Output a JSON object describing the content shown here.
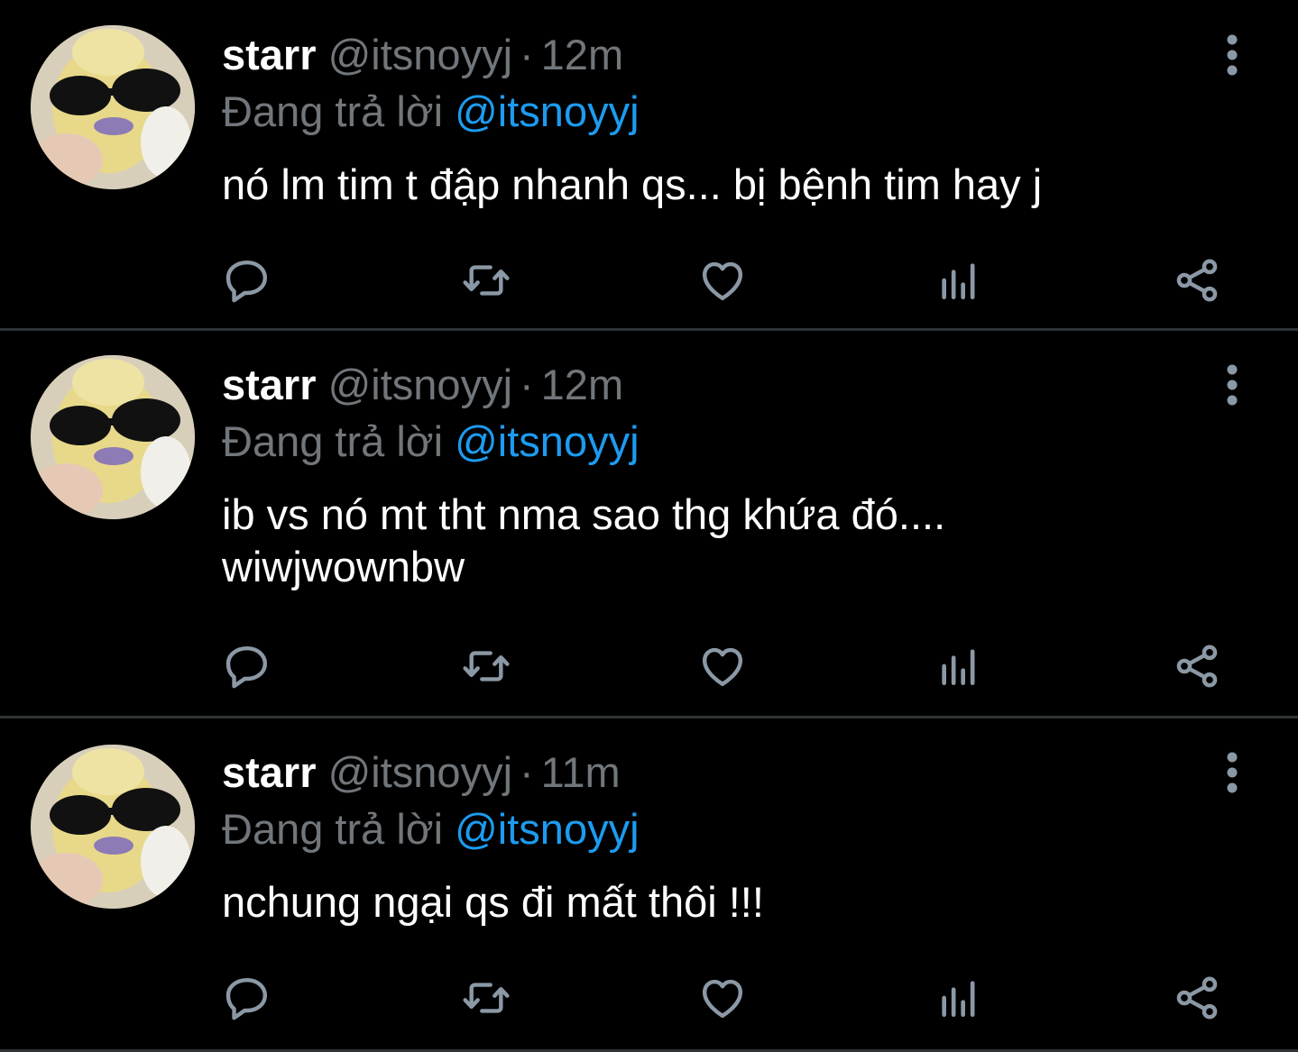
{
  "colors": {
    "background": "#000000",
    "text_primary": "#ffffff",
    "text_secondary": "#71767b",
    "link": "#1d9bf0",
    "divider": "#2f3336"
  },
  "tweets": [
    {
      "display_name": "starr",
      "handle": "@itsnoyyj",
      "separator": "·",
      "time": "12m",
      "replying_prefix": "Đang trả lời",
      "replying_to": "@itsnoyyj",
      "text": "nó lm tim t đập nhanh qs... bị bệnh tim hay j",
      "icons": [
        "reply-icon",
        "retweet-icon",
        "like-icon",
        "analytics-icon",
        "share-icon",
        "more-options-icon"
      ]
    },
    {
      "display_name": "starr",
      "handle": "@itsnoyyj",
      "separator": "·",
      "time": "12m",
      "replying_prefix": "Đang trả lời",
      "replying_to": "@itsnoyyj",
      "text": "ib vs nó mt tht nma sao thg khứa đó....\nwiwjwownbw",
      "icons": [
        "reply-icon",
        "retweet-icon",
        "like-icon",
        "analytics-icon",
        "share-icon",
        "more-options-icon"
      ]
    },
    {
      "display_name": "starr",
      "handle": "@itsnoyyj",
      "separator": "·",
      "time": "11m",
      "replying_prefix": "Đang trả lời",
      "replying_to": "@itsnoyyj",
      "text": "nchung ngại qs đi mất thôi !!!",
      "icons": [
        "reply-icon",
        "retweet-icon",
        "like-icon",
        "analytics-icon",
        "share-icon",
        "more-options-icon"
      ]
    }
  ]
}
